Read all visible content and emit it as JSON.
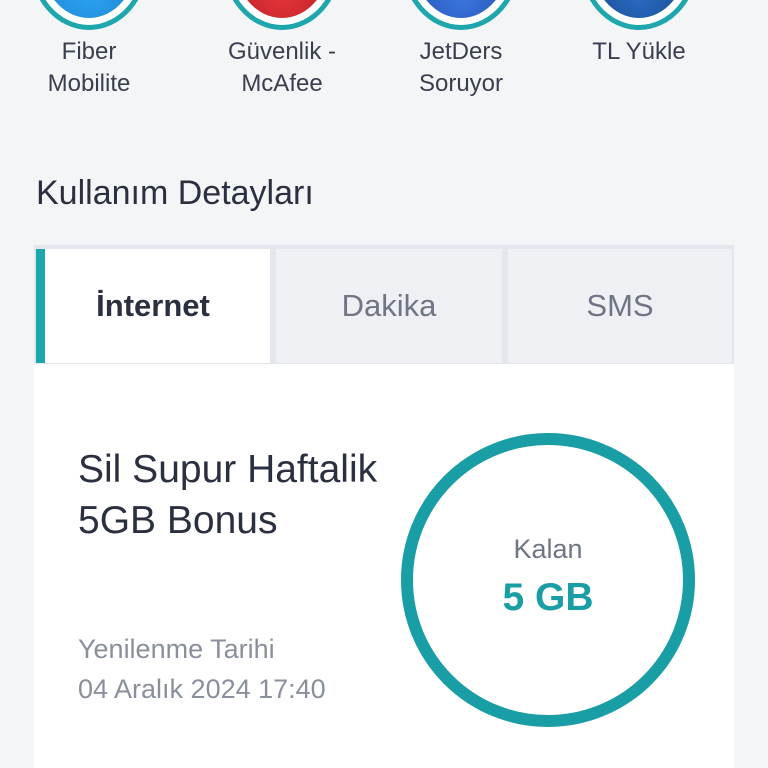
{
  "shortcuts": [
    {
      "label": "Fiber\nMobilite",
      "icon": "fiber-mobilite-icon",
      "color": "#1f8fd6"
    },
    {
      "label": "Güvenlik -\nMcAfee",
      "icon": "mcafee-shield-icon",
      "color": "#c8202b"
    },
    {
      "label": "JetDers\nSoruyor",
      "icon": "jetders-icon",
      "color": "#1c4fb8"
    },
    {
      "label": "TL Yükle",
      "icon": "tl-topup-icon",
      "color": "#123a7a"
    }
  ],
  "usage": {
    "title": "Kullanım Detayları",
    "tabs": [
      "İnternet",
      "Dakika",
      "SMS"
    ],
    "active_tab": "İnternet"
  },
  "package": {
    "name": "Sil Supur Haftalik 5GB Bonus",
    "renew_label": "Yenilenme Tarihi",
    "renew_date": "04 Aralık 2024 17:40"
  },
  "gauge": {
    "label": "Kalan",
    "value": "5 GB",
    "remaining_fraction": 1.0,
    "color": "#1a9ea5"
  }
}
